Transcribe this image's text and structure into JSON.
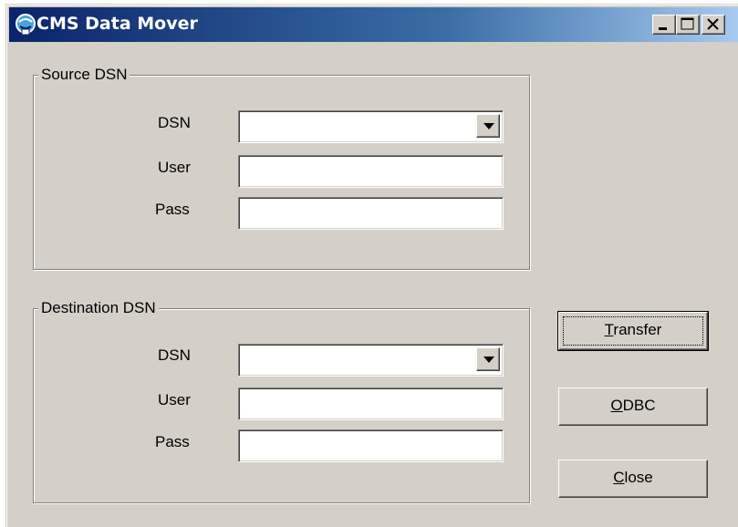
{
  "window": {
    "title": "CMS Data Mover",
    "icon": "cms-app-icon",
    "controls": {
      "minimize": "minimize-icon",
      "maximize": "maximize-icon",
      "close": "close-icon"
    }
  },
  "source": {
    "group_title": "Source DSN",
    "dsn_label": "DSN",
    "dsn_value": "",
    "user_label": "User",
    "user_value": "",
    "pass_label": "Pass",
    "pass_value": ""
  },
  "destination": {
    "group_title": "Destination DSN",
    "dsn_label": "DSN",
    "dsn_value": "",
    "user_label": "User",
    "user_value": "",
    "pass_label": "Pass",
    "pass_value": ""
  },
  "buttons": {
    "transfer": {
      "accel": "T",
      "rest": "ransfer"
    },
    "odbc": {
      "accel": "O",
      "rest": "DBC"
    },
    "close": {
      "accel": "C",
      "rest": "lose"
    }
  },
  "colors": {
    "face": "#d4d0c8",
    "title_start": "#0a246a",
    "title_end": "#a6caf0"
  }
}
